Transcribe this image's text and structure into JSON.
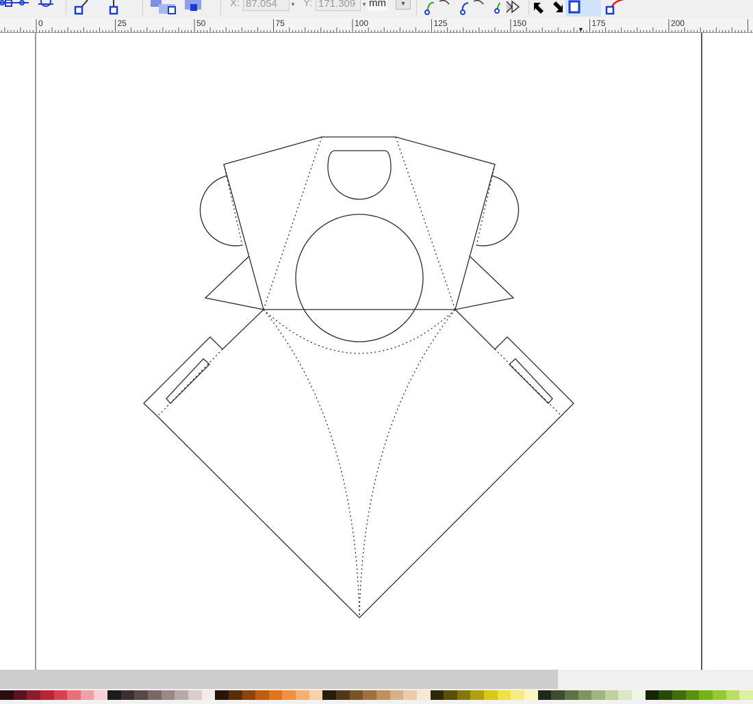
{
  "toolbar": {
    "x_label": "X:",
    "x_value": "87.054",
    "y_label": "Y:",
    "y_value": "171.309",
    "unit": "mm",
    "icons": [
      "node-join-icon",
      "node-break-icon",
      "segment-line-icon",
      "segment-curve-icon",
      "object-to-path-icon",
      "stroke-to-path-icon",
      "node-cusp-icon",
      "node-smooth-icon",
      "node-symmetric-icon",
      "node-auto-icon",
      "show-handles-icon",
      "show-transform-icon",
      "show-clip-icon",
      "show-mask-icon"
    ]
  },
  "ruler": {
    "labels": [
      "0",
      "25",
      "50",
      "75",
      "100",
      "125",
      "150",
      "175",
      "200"
    ],
    "pointer_marker": "▼"
  },
  "colors": {
    "toolbar_bg": "#f0f0f0",
    "ruler_bg": "#f4f4f4",
    "page_border": "#555555",
    "stroke": "#2a2a2a",
    "handle_blue": "#1a3bd6",
    "scroll_thumb": "#cdcdcd"
  },
  "palette": [
    "#2a0d10",
    "#5a1420",
    "#8a1c2c",
    "#b82535",
    "#d84050",
    "#e87078",
    "#f0a0a8",
    "#f6d0d4",
    "#1c1c1c",
    "#3a3030",
    "#5a4848",
    "#7a6868",
    "#9a8888",
    "#baa8a8",
    "#dacccc",
    "#f2ecec",
    "#2a1404",
    "#5a2c08",
    "#8a440c",
    "#c05c10",
    "#e07418",
    "#f09040",
    "#f6b070",
    "#fad0a4",
    "#281c0c",
    "#503818",
    "#785428",
    "#a07040",
    "#c09060",
    "#d8b088",
    "#e8ccac",
    "#f6e8d4",
    "#2c2804",
    "#585008",
    "#84780c",
    "#b0a010",
    "#d8c818",
    "#f0e040",
    "#f6ec80",
    "#fcf6c0",
    "#202818",
    "#404c30",
    "#607048",
    "#809460",
    "#a0b480",
    "#c0d0a0",
    "#dce8c4",
    "#f0f6e4",
    "#142404",
    "#284808",
    "#406c0c",
    "#589010",
    "#74b418",
    "#94cc30",
    "#b8e060",
    "#dcf0a0"
  ]
}
